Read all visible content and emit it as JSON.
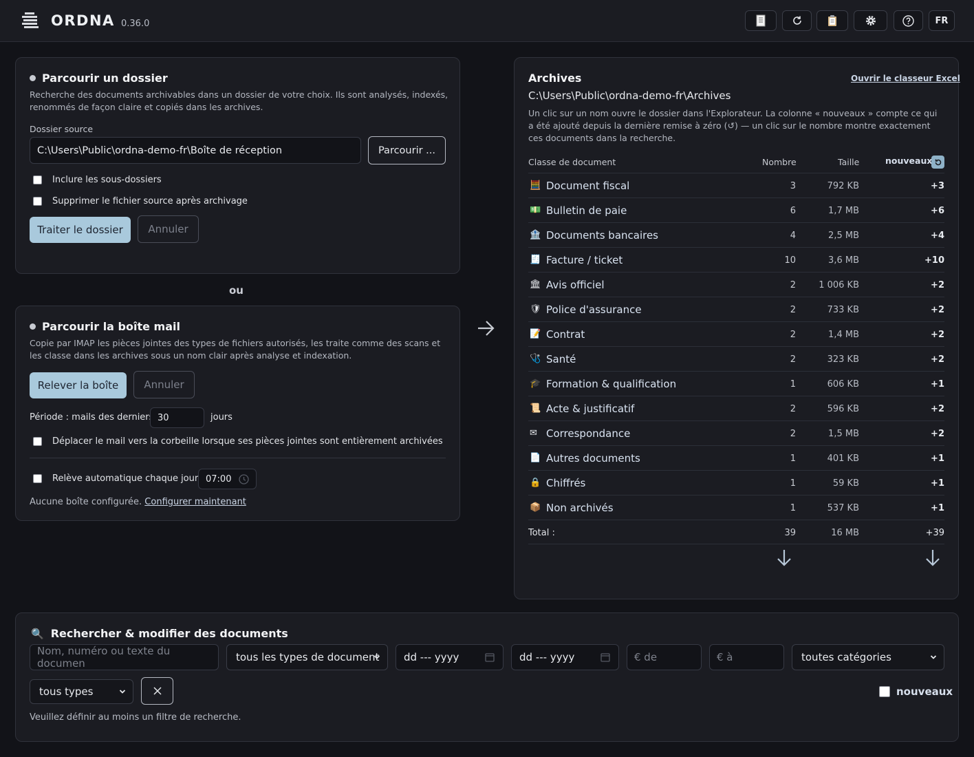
{
  "header": {
    "brand": "ORDNA",
    "version": "0.36.0",
    "lang": "FR",
    "icons": [
      "document-icon",
      "refresh-icon",
      "clipboard-icon",
      "gear-icon",
      "help-icon"
    ]
  },
  "folder_card": {
    "title": "Parcourir un dossier",
    "description": "Recherche des documents archivables dans un dossier de votre choix. Ils sont analysés, indexés, renommés de façon claire et copiés dans les archives.",
    "source_label": "Dossier source",
    "source_value": "C:\\Users\\Public\\ordna-demo-fr\\Boîte de réception",
    "browse_label": "Parcourir ...",
    "include_subfolders": "Inclure les sous-dossiers",
    "delete_source": "Supprimer le fichier source après archivage",
    "process_label": "Traiter le dossier",
    "cancel_label": "Annuler"
  },
  "separator": "ou",
  "mail_card": {
    "title": "Parcourir la boîte mail",
    "description": "Copie par IMAP les pièces jointes des types de fichiers autorisés, les traite comme des scans et les classe dans les archives sous un nom clair après analyse et indexation.",
    "fetch_label": "Relever la boîte",
    "cancel_label": "Annuler",
    "period_label": "Période : mails des derniers",
    "period_value": "30",
    "period_unit": "jours",
    "move_to_trash": "Déplacer le mail vers la corbeille lorsque ses pièces jointes sont entièrement archivées",
    "auto_fetch": "Relève automatique chaque jour à",
    "auto_time": "07:00",
    "no_mailbox": "Aucune boîte configurée.",
    "configure_now": "Configurer maintenant"
  },
  "archives": {
    "title": "Archives",
    "excel_link": "Ouvrir le classeur Excel",
    "path": "C:\\Users\\Public\\ordna-demo-fr\\Archives",
    "description": "Un clic sur un nom ouvre le dossier dans l'Explorateur. La colonne « nouveaux » compte ce qui a été ajouté depuis la dernière remise à zéro (↺) — un clic sur le nombre montre exactement ces documents dans la recherche.",
    "columns": {
      "class": "Classe de document",
      "count": "Nombre",
      "size": "Taille",
      "new": "nouveaux"
    },
    "rows": [
      {
        "icon": "🧮",
        "name": "Document fiscal",
        "count": "3",
        "size": "792 KB",
        "new": "+3"
      },
      {
        "icon": "💵",
        "name": "Bulletin de paie",
        "count": "6",
        "size": "1,7 MB",
        "new": "+6"
      },
      {
        "icon": "🏦",
        "name": "Documents bancaires",
        "count": "4",
        "size": "2,5 MB",
        "new": "+4"
      },
      {
        "icon": "🧾",
        "name": "Facture / ticket",
        "count": "10",
        "size": "3,6 MB",
        "new": "+10"
      },
      {
        "icon": "🏛",
        "name": "Avis officiel",
        "count": "2",
        "size": "1 006 KB",
        "new": "+2"
      },
      {
        "icon": "🛡",
        "name": "Police d'assurance",
        "count": "2",
        "size": "733 KB",
        "new": "+2"
      },
      {
        "icon": "📝",
        "name": "Contrat",
        "count": "2",
        "size": "1,4 MB",
        "new": "+2"
      },
      {
        "icon": "🩺",
        "name": "Santé",
        "count": "2",
        "size": "323 KB",
        "new": "+2"
      },
      {
        "icon": "🎓",
        "name": "Formation & qualification",
        "count": "1",
        "size": "606 KB",
        "new": "+1"
      },
      {
        "icon": "📜",
        "name": "Acte & justificatif",
        "count": "2",
        "size": "596 KB",
        "new": "+2"
      },
      {
        "icon": "✉",
        "name": "Correspondance",
        "count": "2",
        "size": "1,5 MB",
        "new": "+2"
      },
      {
        "icon": "📄",
        "name": "Autres documents",
        "count": "1",
        "size": "401 KB",
        "new": "+1"
      },
      {
        "icon": "🔒",
        "name": "Chiffrés",
        "count": "1",
        "size": "59 KB",
        "new": "+1"
      },
      {
        "icon": "📦",
        "name": "Non archivés",
        "count": "1",
        "size": "537 KB",
        "new": "+1"
      }
    ],
    "total": {
      "label": "Total :",
      "count": "39",
      "size": "16 MB",
      "new": "+39"
    }
  },
  "search": {
    "title": "Rechercher & modifier des documents",
    "text_placeholder": "Nom, numéro ou texte du documen",
    "doc_type_value": "tous les types de document",
    "date_placeholder": "dd --- yyyy",
    "amount_from": "€ de",
    "amount_to": "€ à",
    "category_value": "toutes catégories",
    "type_value": "tous types",
    "new_label": "nouveaux",
    "hint": "Veuillez définir au moins un filtre de recherche."
  }
}
